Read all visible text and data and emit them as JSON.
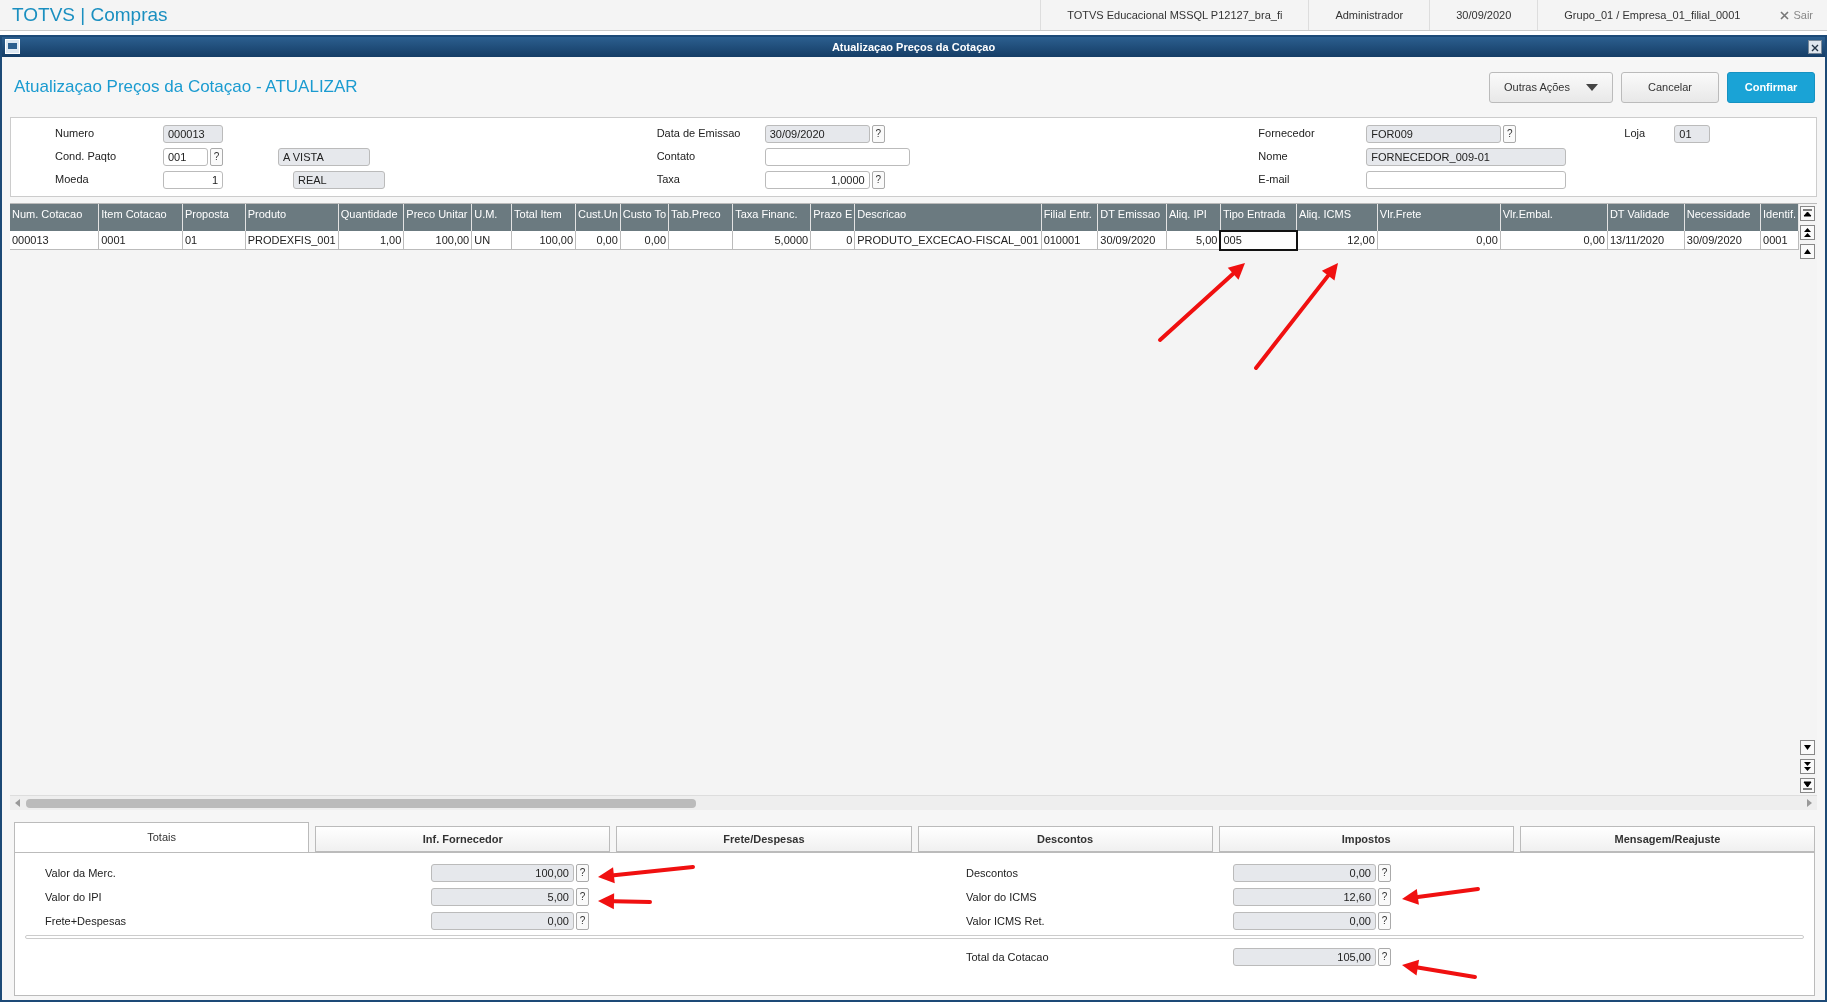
{
  "app_bar": {
    "title": "TOTVS | Compras",
    "items": [
      "TOTVS Educacional MSSQL P12127_bra_fi",
      "Administrador",
      "30/09/2020",
      "Grupo_01 / Empresa_01_filial_0001"
    ],
    "exit": "Sair"
  },
  "window": {
    "title": "Atualizaçao Preços da Cotaçao"
  },
  "header": {
    "title": "Atualizaçao Preços da Cotaçao - ATUALIZAR",
    "buttons": [
      {
        "label": "Outras Ações",
        "kind": "menu"
      },
      {
        "label": "Cancelar",
        "kind": "plain"
      },
      {
        "label": "Confirmar",
        "kind": "primary"
      }
    ]
  },
  "form": {
    "columns": [
      [
        {
          "label": "Numero",
          "value": "000013",
          "editable": false,
          "kind": "text"
        },
        {
          "label": "Cond. Paqto",
          "value": "001",
          "editable": true,
          "lookup": "?",
          "kind": "text",
          "extra": "A VISTA"
        },
        {
          "label": "Moeda",
          "value": "1",
          "editable": true,
          "kind": "number",
          "extra": "REAL"
        }
      ],
      [
        {
          "label": "Data de Emissao",
          "value": "30/09/2020",
          "editable": false,
          "lookup": "?",
          "kind": "text"
        },
        {
          "label": "Contato",
          "editable": true,
          "kind": "text"
        },
        {
          "label": "Taxa",
          "value": "1,0000",
          "editable": true,
          "lookup": "?",
          "kind": "number"
        }
      ],
      [
        {
          "label": "Fornecedor",
          "value": "FOR009",
          "editable": false,
          "lookup": "?",
          "kind": "text",
          "side_label": "Loja",
          "side_value": "01"
        },
        {
          "label": "Nome",
          "value": "FORNECEDOR_009-01",
          "editable": false,
          "kind": "text"
        },
        {
          "label": "E-mail",
          "editable": true,
          "kind": "text"
        }
      ]
    ]
  },
  "grid": {
    "columns": [
      {
        "label": "Num. Cotacao",
        "kind": "text"
      },
      {
        "label": "Item Cotacao",
        "kind": "text"
      },
      {
        "label": "Proposta",
        "kind": "text"
      },
      {
        "label": "Produto",
        "kind": "text"
      },
      {
        "label": "Quantidade",
        "kind": "number"
      },
      {
        "label": "Preco Unitar",
        "kind": "number"
      },
      {
        "label": "U.M.",
        "kind": "text"
      },
      {
        "label": "Total Item",
        "kind": "number"
      },
      {
        "label": "Cust.Un",
        "kind": "number"
      },
      {
        "label": "Custo To",
        "kind": "number"
      },
      {
        "label": "Tab.Preco",
        "kind": "text"
      },
      {
        "label": "Taxa Financ.",
        "kind": "number"
      },
      {
        "label": "Prazo E",
        "kind": "number"
      },
      {
        "label": "Descricao",
        "kind": "text"
      },
      {
        "label": "Filial Entr.",
        "kind": "text"
      },
      {
        "label": "DT Emissao",
        "kind": "text"
      },
      {
        "label": "Aliq. IPI",
        "kind": "number"
      },
      {
        "label": "Tipo Entrada",
        "kind": "text"
      },
      {
        "label": "Aliq. ICMS",
        "kind": "number"
      },
      {
        "label": "Vlr.Frete",
        "kind": "number"
      },
      {
        "label": "Vlr.Embal.",
        "kind": "number"
      },
      {
        "label": "DT Validade",
        "kind": "text"
      },
      {
        "label": "Necessidade",
        "kind": "text"
      },
      {
        "label": "Identif.",
        "kind": "text"
      }
    ],
    "rows": [
      {
        "cells": [
          {
            "text": "000013",
            "focused": false
          },
          {
            "text": "0001",
            "focused": false
          },
          {
            "text": "01",
            "focused": false
          },
          {
            "text": "PRODEXFIS_001",
            "focused": false
          },
          {
            "text": "1,00",
            "focused": false
          },
          {
            "text": "100,00",
            "focused": false
          },
          {
            "text": "UN",
            "focused": false
          },
          {
            "text": "100,00",
            "focused": false
          },
          {
            "text": "0,00",
            "focused": false
          },
          {
            "text": "0,00",
            "focused": false
          },
          {
            "focused": false
          },
          {
            "text": "5,0000",
            "focused": false
          },
          {
            "text": "0",
            "focused": false
          },
          {
            "text": "PRODUTO_EXCECAO-FISCAL_001",
            "focused": false
          },
          {
            "text": "010001",
            "focused": false
          },
          {
            "text": "30/09/2020",
            "focused": false
          },
          {
            "text": "5,00",
            "focused": false
          },
          {
            "text": "005",
            "focused": true
          },
          {
            "text": "12,00",
            "focused": false
          },
          {
            "text": "0,00",
            "focused": false
          },
          {
            "text": "0,00",
            "focused": false
          },
          {
            "text": "13/11/2020",
            "focused": false
          },
          {
            "text": "30/09/2020",
            "focused": false
          },
          {
            "text": "0001",
            "focused": false
          }
        ]
      }
    ]
  },
  "tabs": [
    {
      "label": "Totais",
      "selected": true
    },
    {
      "label": "Inf. Fornecedor",
      "selected": false
    },
    {
      "label": "Frete/Despesas",
      "selected": false
    },
    {
      "label": "Descontos",
      "selected": false
    },
    {
      "label": "Impostos",
      "selected": false
    },
    {
      "label": "Mensagem/Reajuste",
      "selected": false
    }
  ],
  "totals": {
    "left": [
      {
        "label": "Valor da Merc.",
        "value": "100,00",
        "lookup": "?"
      },
      {
        "label": "Valor do IPI",
        "value": "5,00",
        "lookup": "?"
      },
      {
        "label": "Frete+Despesas",
        "value": "0,00",
        "lookup": "?"
      }
    ],
    "right": [
      {
        "label": "Descontos",
        "value": "0,00",
        "lookup": "?"
      },
      {
        "label": "Valor do ICMS",
        "value": "12,60",
        "lookup": "?"
      },
      {
        "label": "Valor ICMS Ret.",
        "value": "0,00",
        "lookup": "?"
      }
    ],
    "total": {
      "label": "Total da Cotacao",
      "value": "105,00",
      "lookup": "?"
    }
  }
}
